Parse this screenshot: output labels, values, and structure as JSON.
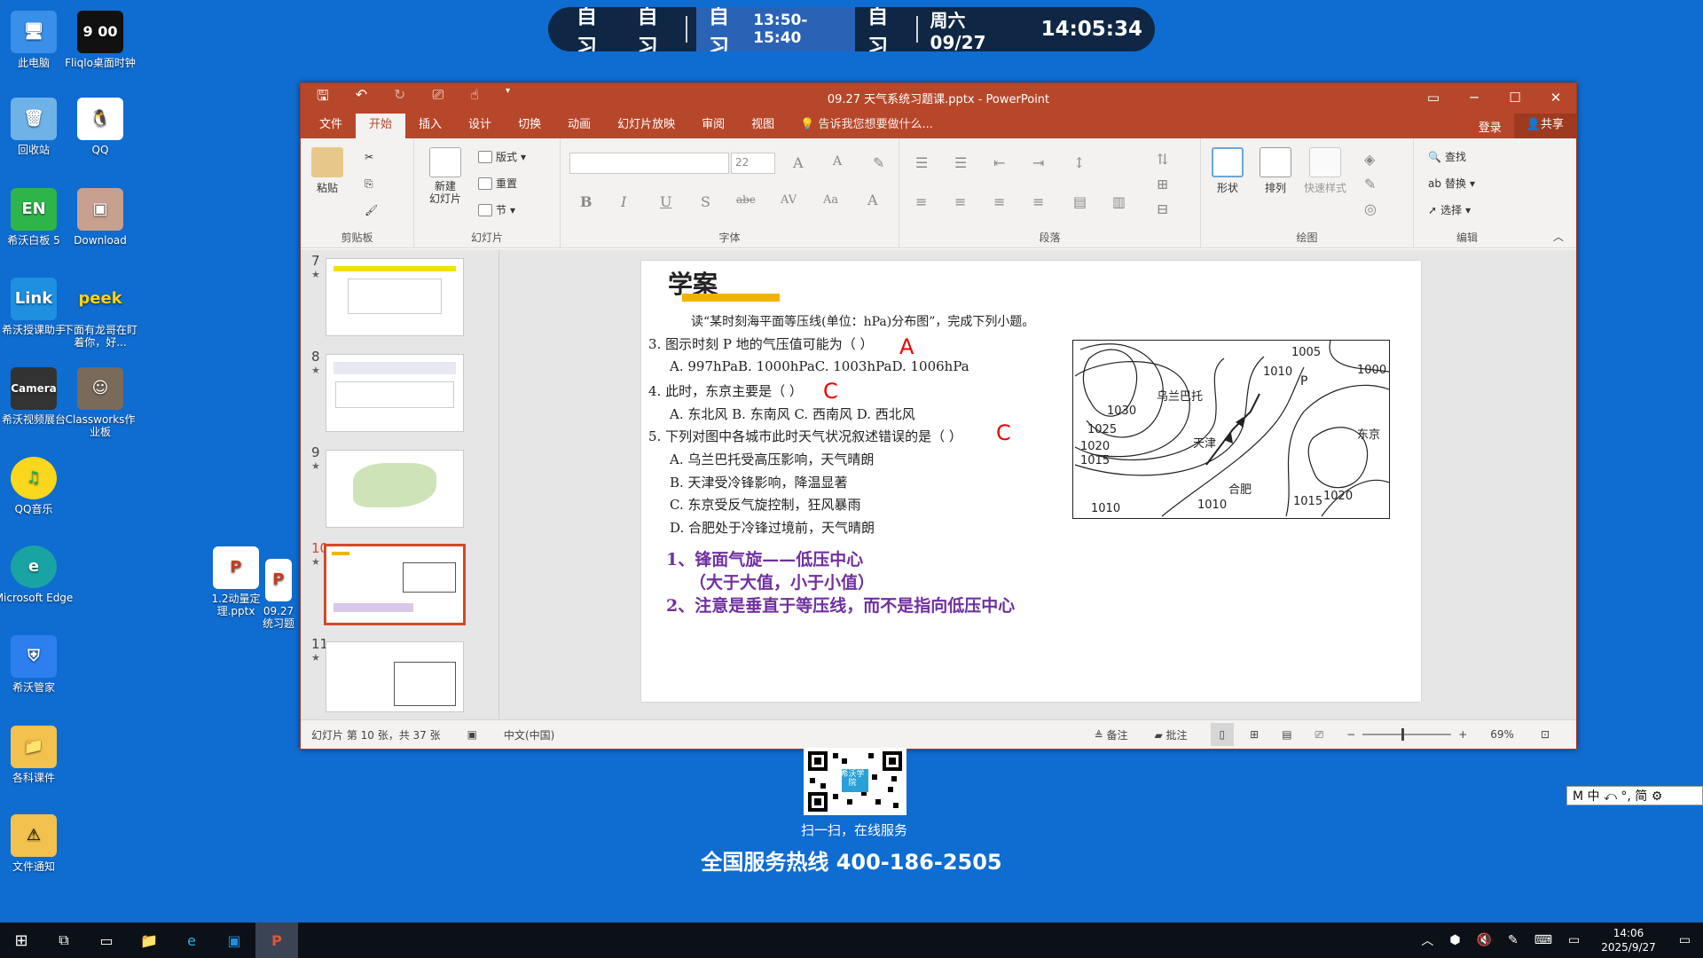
{
  "desktop": {
    "icons": [
      "此电脑",
      "Fliqlo桌面时钟",
      "回收站",
      "QQ",
      "希沃白板 5",
      "Download",
      "希沃授课助手",
      "下面有龙哥在盯着你，好...",
      "希沃视频展台",
      "Classworks作业板",
      "QQ音乐",
      "Microsoft Edge",
      "希沃管家",
      "各科课件",
      "文件通知",
      "1.2动量定理.pptx",
      "09.27 统习题"
    ]
  },
  "schedule": {
    "s1": "自习",
    "s2": "自习",
    "s3": "自习",
    "s3_time": "13:50-15:40",
    "s4": "自习",
    "date": "周六 09/27",
    "time": "14:05:34"
  },
  "ppt": {
    "title": "09.27 天气系统习题课.pptx - PowerPoint",
    "tabs": [
      "文件",
      "开始",
      "插入",
      "设计",
      "切换",
      "动画",
      "幻灯片放映",
      "审阅",
      "视图"
    ],
    "tell": "告诉我您想要做什么...",
    "login": "登录",
    "share": "共享",
    "ribbon": {
      "paste": "粘贴",
      "clipboard": "剪贴板",
      "new_slide": "新建\n幻灯片",
      "layout": "版式",
      "reset": "重置",
      "section": "节",
      "slides": "幻灯片",
      "font_size": "22",
      "font": "字体",
      "paragraph": "段落",
      "shape": "形状",
      "arrange": "排列",
      "quick_style": "快速样式",
      "drawing": "绘图",
      "find": "查找",
      "replace": "替换",
      "select": "选择",
      "editing": "编辑"
    },
    "thumbs": [
      "7",
      "8",
      "9",
      "10",
      "11"
    ],
    "slide": {
      "heading": "学案",
      "intro": "读“某时刻海平面等压线(单位：hPa)分布图”，完成下列小题。",
      "q3": "3. 图示时刻 P 地的气压值可能为（      ）",
      "q3_opts": "A. 997hPaB. 1000hPaC. 1003hPaD. 1006hPa",
      "q3_ans": "A",
      "q4": "4. 此时，东京主要是（      ）",
      "q4_opts": "A. 东北风 B. 东南风 C. 西南风 D. 西北风",
      "q4_ans": "C",
      "q5": "5. 下列对图中各城市此时天气状况叙述错误的是（      ）",
      "q5_ans": "C",
      "q5_a": "A. 乌兰巴托受高压影响，天气晴朗",
      "q5_b": "B. 天津受冷锋影响，降温显著",
      "q5_c": "C. 东京受反气旋控制，狂风暴雨",
      "q5_d": "D. 合肥处于冷锋过境前，天气晴朗",
      "note1": "1、锋面气旋——低压中心",
      "note2": "（大于大值，小于小值）",
      "note3": "2、注意是垂直于等压线，而不是指向低压中心",
      "map": {
        "labels": [
          "乌兰巴托",
          "天津",
          "合肥",
          "东京",
          "P"
        ],
        "isobars": [
          "1005",
          "1010",
          "1000",
          "1030",
          "1025",
          "1020",
          "1015",
          "1010",
          "1010",
          "1015",
          "1020"
        ]
      }
    },
    "status": {
      "slide_info": "幻灯片 第 10 张，共 37 张",
      "lang": "中文(中国)",
      "notes": "备注",
      "comments": "批注",
      "zoom": "69%"
    }
  },
  "promo": {
    "qr_label": "希沃学院",
    "scan": "扫一扫，在线服务",
    "hotline": "全国服务热线 400-186-2505"
  },
  "ime": {
    "text": "M 中 ⤺ °, 简 ⚙"
  },
  "tray": {
    "time": "14:06",
    "date": "2025/9/27"
  }
}
